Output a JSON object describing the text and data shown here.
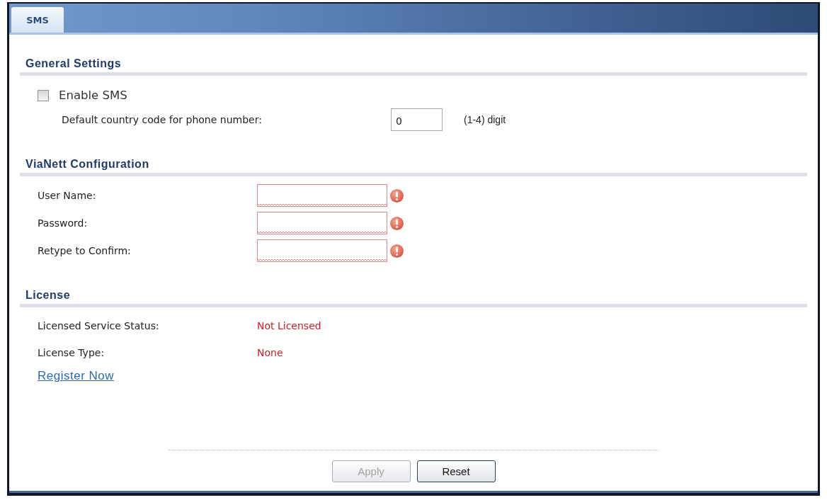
{
  "tabs": [
    {
      "label": "SMS",
      "selected": true
    }
  ],
  "sections": [
    {
      "title": "General Settings",
      "rows": [
        {
          "kind": "checkbox",
          "label": "Enable SMS",
          "checked": false
        },
        {
          "kind": "number",
          "label": "Default country code for phone number:",
          "value": "0",
          "hint": "(1-4) digit"
        }
      ]
    },
    {
      "title": "ViaNett Configuration",
      "rows": [
        {
          "kind": "field",
          "label": "User Name:",
          "invalid": true
        },
        {
          "kind": "password",
          "label": "Password:",
          "invalid": true
        },
        {
          "kind": "password",
          "label": "Retype to Confirm:",
          "invalid": true
        }
      ]
    },
    {
      "title": "License",
      "rows": [
        {
          "kind": "info",
          "label": "Licensed Service Status:",
          "value": "Not Licensed"
        },
        {
          "kind": "info",
          "label": "License Type:",
          "value": "None"
        },
        {
          "kind": "link",
          "label": "Register Now"
        }
      ]
    }
  ],
  "buttons": [
    {
      "label": "Apply",
      "disabled": true
    },
    {
      "label": "Reset",
      "disabled": false
    }
  ]
}
